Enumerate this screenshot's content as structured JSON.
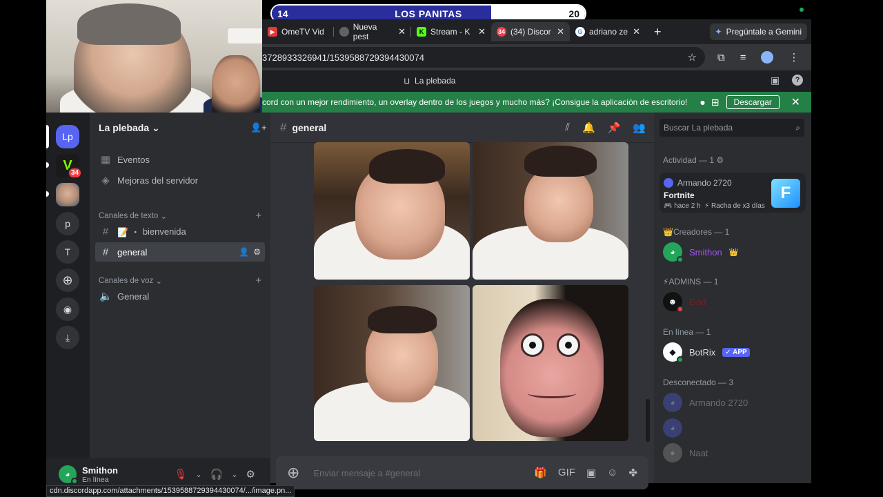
{
  "scoreboard": {
    "left_score": "14",
    "title": "LOS PANITAS",
    "right_score": "20"
  },
  "browser": {
    "tabs": [
      {
        "label": "OmeTV Vid",
        "favicon_color": "#e53935"
      },
      {
        "label": "Nueva pest",
        "favicon_color": "#9aa0a6"
      },
      {
        "label": "Stream - K",
        "favicon_color": "#53fc18"
      },
      {
        "label": "(34) Discor",
        "favicon_color": "#f23f43",
        "active": true
      },
      {
        "label": "adriano ze",
        "favicon_color": "#4285f4"
      }
    ],
    "gemini_label": "Pregúntale a Gemini",
    "url": "3728933326941/1539588729394430074"
  },
  "discord": {
    "top_title": "La plebada",
    "banner": {
      "text": "cord con un mejor rendimiento, un overlay dentro de los juegos y mucho más? ¡Consigue la aplicación de escritorio!",
      "button": "Descargar"
    },
    "guilds": [
      {
        "label": "Lp"
      },
      {
        "label": "V",
        "badge": "34"
      },
      {
        "label": ""
      },
      {
        "label": "p"
      },
      {
        "label": "T"
      }
    ],
    "server": {
      "name": "La plebada",
      "items": [
        {
          "icon": "calendar-icon",
          "label": "Eventos"
        },
        {
          "icon": "boost-icon",
          "label": "Mejoras del servidor"
        }
      ],
      "text_category": "Canales de texto",
      "text_channels": [
        {
          "label": "bienvenida",
          "prefix": "📝 ・"
        },
        {
          "label": "general",
          "active": true
        }
      ],
      "voice_category": "Canales de voz",
      "voice_channels": [
        {
          "label": "General"
        }
      ]
    },
    "user": {
      "name": "Smithon",
      "status": "En línea"
    },
    "chat": {
      "channel": "general",
      "placeholder": "Enviar mensaje a #general"
    },
    "members": {
      "search_placeholder": "Buscar La plebada",
      "activity_header": "Actividad — 1",
      "activity": {
        "user": "Armando 2720",
        "game": "Fortnite",
        "ago": "hace 2 h",
        "streak": "Racha de x3 días",
        "tile": "F"
      },
      "creators_header": "Creadores — 1",
      "creators": [
        {
          "name": "Smithon",
          "color": "#a855f7"
        }
      ],
      "admins_header": "ADMINS — 1",
      "admins": [
        {
          "name": "God",
          "color": "#8b1a1a"
        }
      ],
      "online_header": "En línea — 1",
      "online": [
        {
          "name": "BotRix",
          "badge": "APP"
        }
      ],
      "offline_header": "Desconectado — 3",
      "offline": [
        {
          "name": "Armando 2720"
        },
        {
          "name": ""
        },
        {
          "name": "Naat"
        }
      ]
    },
    "status_url": "cdn.discordapp.com/attachments/1539588729394430074/.../image.pn..."
  },
  "colors": {
    "blurple": "#5865f2",
    "green": "#23a55a",
    "red": "#f23f43",
    "banner": "#248046"
  }
}
